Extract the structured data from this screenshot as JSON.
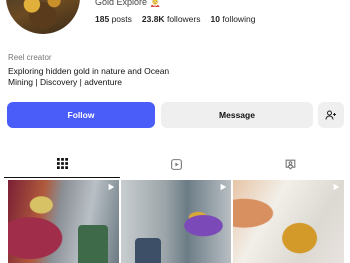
{
  "profile": {
    "name": "Gold Explore 🤶",
    "stats": [
      {
        "value": "185",
        "label": "posts"
      },
      {
        "value": "23.8K",
        "label": "followers"
      },
      {
        "value": "10",
        "label": "following"
      }
    ],
    "category": "Reel creator",
    "bio_line1": "Exploring hidden gold in nature and Ocean",
    "bio_line2": "Mining | Discovery | adventure"
  },
  "actions": {
    "follow_label": "Follow",
    "message_label": "Message",
    "add_user_icon": "add-user-icon"
  },
  "tabs": [
    {
      "icon": "grid-icon",
      "active": true
    },
    {
      "icon": "reels-icon",
      "active": false
    },
    {
      "icon": "tagged-icon",
      "active": false
    }
  ],
  "colors": {
    "accent": "#4a5df9",
    "secondary_button": "#efefef"
  }
}
